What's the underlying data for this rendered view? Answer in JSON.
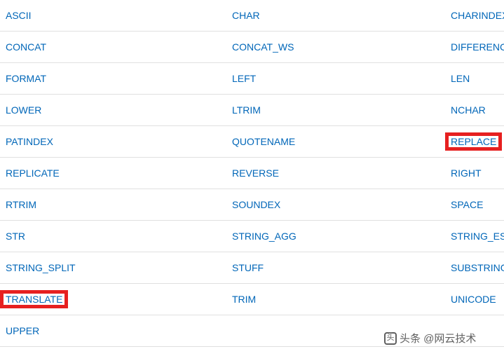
{
  "functions": {
    "rows": [
      {
        "c1": "ASCII",
        "c2": "CHAR",
        "c3": "CHARINDEX",
        "hl1": false,
        "hl3": false
      },
      {
        "c1": "CONCAT",
        "c2": "CONCAT_WS",
        "c3": "DIFFERENCE",
        "hl1": false,
        "hl3": false
      },
      {
        "c1": "FORMAT",
        "c2": "LEFT",
        "c3": "LEN",
        "hl1": false,
        "hl3": false
      },
      {
        "c1": "LOWER",
        "c2": "LTRIM",
        "c3": "NCHAR",
        "hl1": false,
        "hl3": false
      },
      {
        "c1": "PATINDEX",
        "c2": "QUOTENAME",
        "c3": "REPLACE",
        "hl1": false,
        "hl3": true
      },
      {
        "c1": "REPLICATE",
        "c2": "REVERSE",
        "c3": "RIGHT",
        "hl1": false,
        "hl3": false
      },
      {
        "c1": "RTRIM",
        "c2": "SOUNDEX",
        "c3": "SPACE",
        "hl1": false,
        "hl3": false
      },
      {
        "c1": "STR",
        "c2": "STRING_AGG",
        "c3": "STRING_ESCAPE",
        "hl1": false,
        "hl3": false
      },
      {
        "c1": "STRING_SPLIT",
        "c2": "STUFF",
        "c3": "SUBSTRING",
        "hl1": false,
        "hl3": false
      },
      {
        "c1": "TRANSLATE",
        "c2": "TRIM",
        "c3": "UNICODE",
        "hl1": true,
        "hl3": false
      },
      {
        "c1": "UPPER",
        "c2": "",
        "c3": "",
        "hl1": false,
        "hl3": false
      }
    ]
  },
  "watermark": {
    "text": "头条 @网云技术",
    "icon_glyph": "头"
  }
}
